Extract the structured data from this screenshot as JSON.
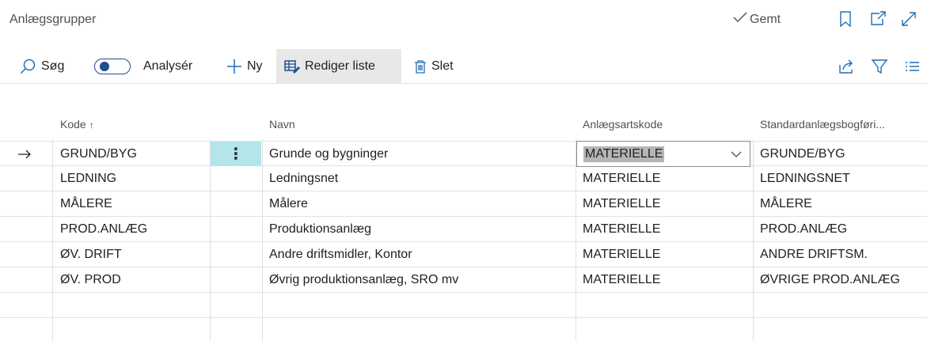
{
  "page": {
    "title": "Anlægsgrupper",
    "saved_label": "Gemt"
  },
  "toolbar": {
    "search_label": "Søg",
    "analyze_label": "Analysér",
    "new_label": "Ny",
    "edit_list_label": "Rediger liste",
    "delete_label": "Slet"
  },
  "icons": {
    "saved": "check-icon",
    "bookmark": "bookmark-icon",
    "open_new": "open-in-new-window-icon",
    "expand": "expand-icon",
    "share": "share-icon",
    "filter": "filter-icon",
    "list": "list-view-icon",
    "search": "search-icon",
    "new": "plus-icon",
    "edit_list": "edit-list-icon",
    "delete": "trash-icon",
    "sort": "sort-ascending-icon",
    "current_row": "arrow-right-icon",
    "row_actions": "more-vertical-icon",
    "dropdown": "chevron-down-icon"
  },
  "colors": {
    "accent": "#1f6fb5",
    "toggle": "#1f4e8c",
    "selected_cell": "#b3e5eb",
    "active_button": "#e8e8e8"
  },
  "table": {
    "columns": [
      "Kode",
      "Navn",
      "Anlægsartskode",
      "Standardanlægsbogføri..."
    ],
    "rows": [
      {
        "kode": "GRUND/BYG",
        "navn": "Grunde og bygninger",
        "art": "MATERIELLE",
        "std": "GRUNDE/BYG"
      },
      {
        "kode": "LEDNING",
        "navn": "Ledningsnet",
        "art": "MATERIELLE",
        "std": "LEDNINGSNET"
      },
      {
        "kode": "MÅLERE",
        "navn": "Målere",
        "art": "MATERIELLE",
        "std": "MÅLERE"
      },
      {
        "kode": "PROD.ANLÆG",
        "navn": "Produktionsanlæg",
        "art": "MATERIELLE",
        "std": "PROD.ANLÆG"
      },
      {
        "kode": "ØV. DRIFT",
        "navn": "Andre driftsmidler, Kontor",
        "art": "MATERIELLE",
        "std": "ANDRE DRIFTSM."
      },
      {
        "kode": "ØV. PROD",
        "navn": "Øvrig produktionsanlæg, SRO mv",
        "art": "MATERIELLE",
        "std": "ØVRIGE PROD.ANLÆG"
      }
    ]
  }
}
